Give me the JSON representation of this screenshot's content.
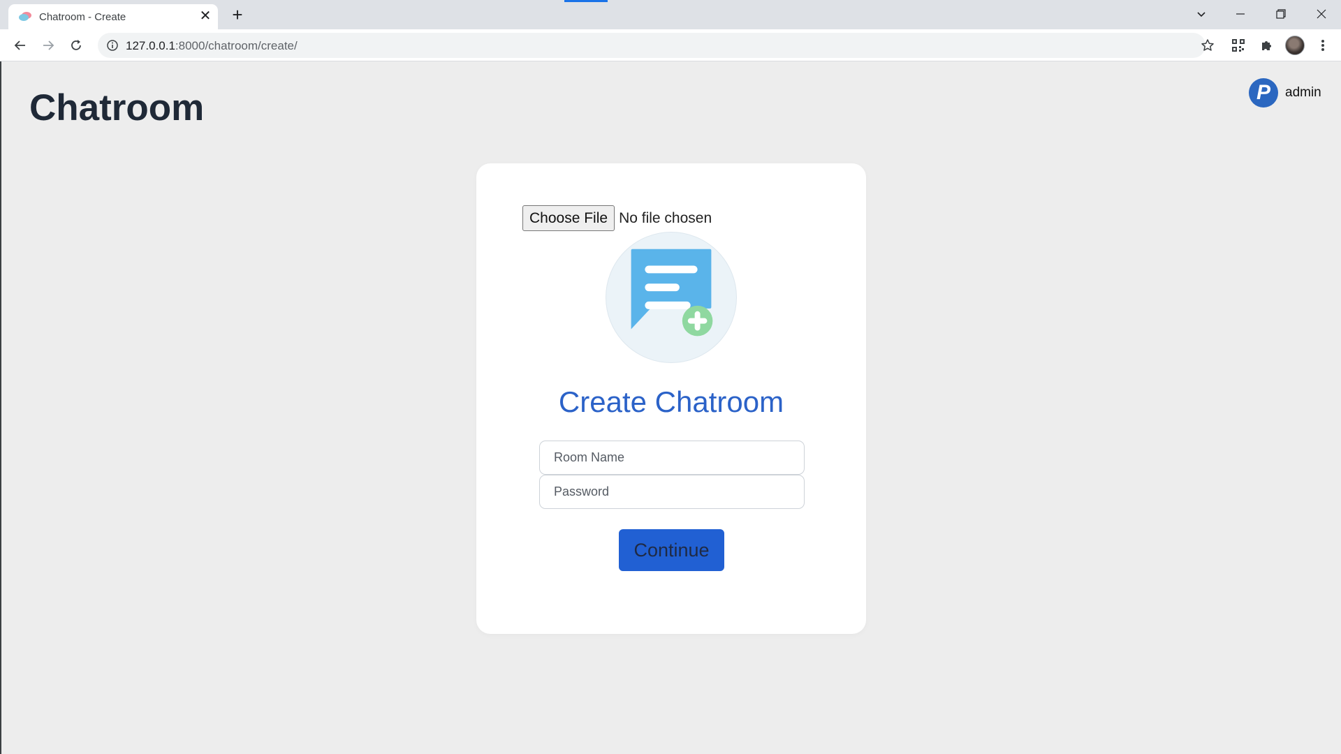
{
  "browser": {
    "tab_title": "Chatroom - Create",
    "url_host": "127.0.0.1",
    "url_path": ":8000/chatroom/create/"
  },
  "page": {
    "title": "Chatroom",
    "user_initial": "P",
    "username": "admin"
  },
  "form": {
    "file_button": "Choose File",
    "file_status": "No file chosen",
    "heading": "Create Chatroom",
    "room_name_placeholder": "Room Name",
    "password_placeholder": "Password",
    "submit_label": "Continue"
  },
  "colors": {
    "accent": "#2160d3",
    "heading": "#2b62c8",
    "icon_bubble": "#5ab4ea",
    "icon_plus": "#8fd8a0"
  }
}
